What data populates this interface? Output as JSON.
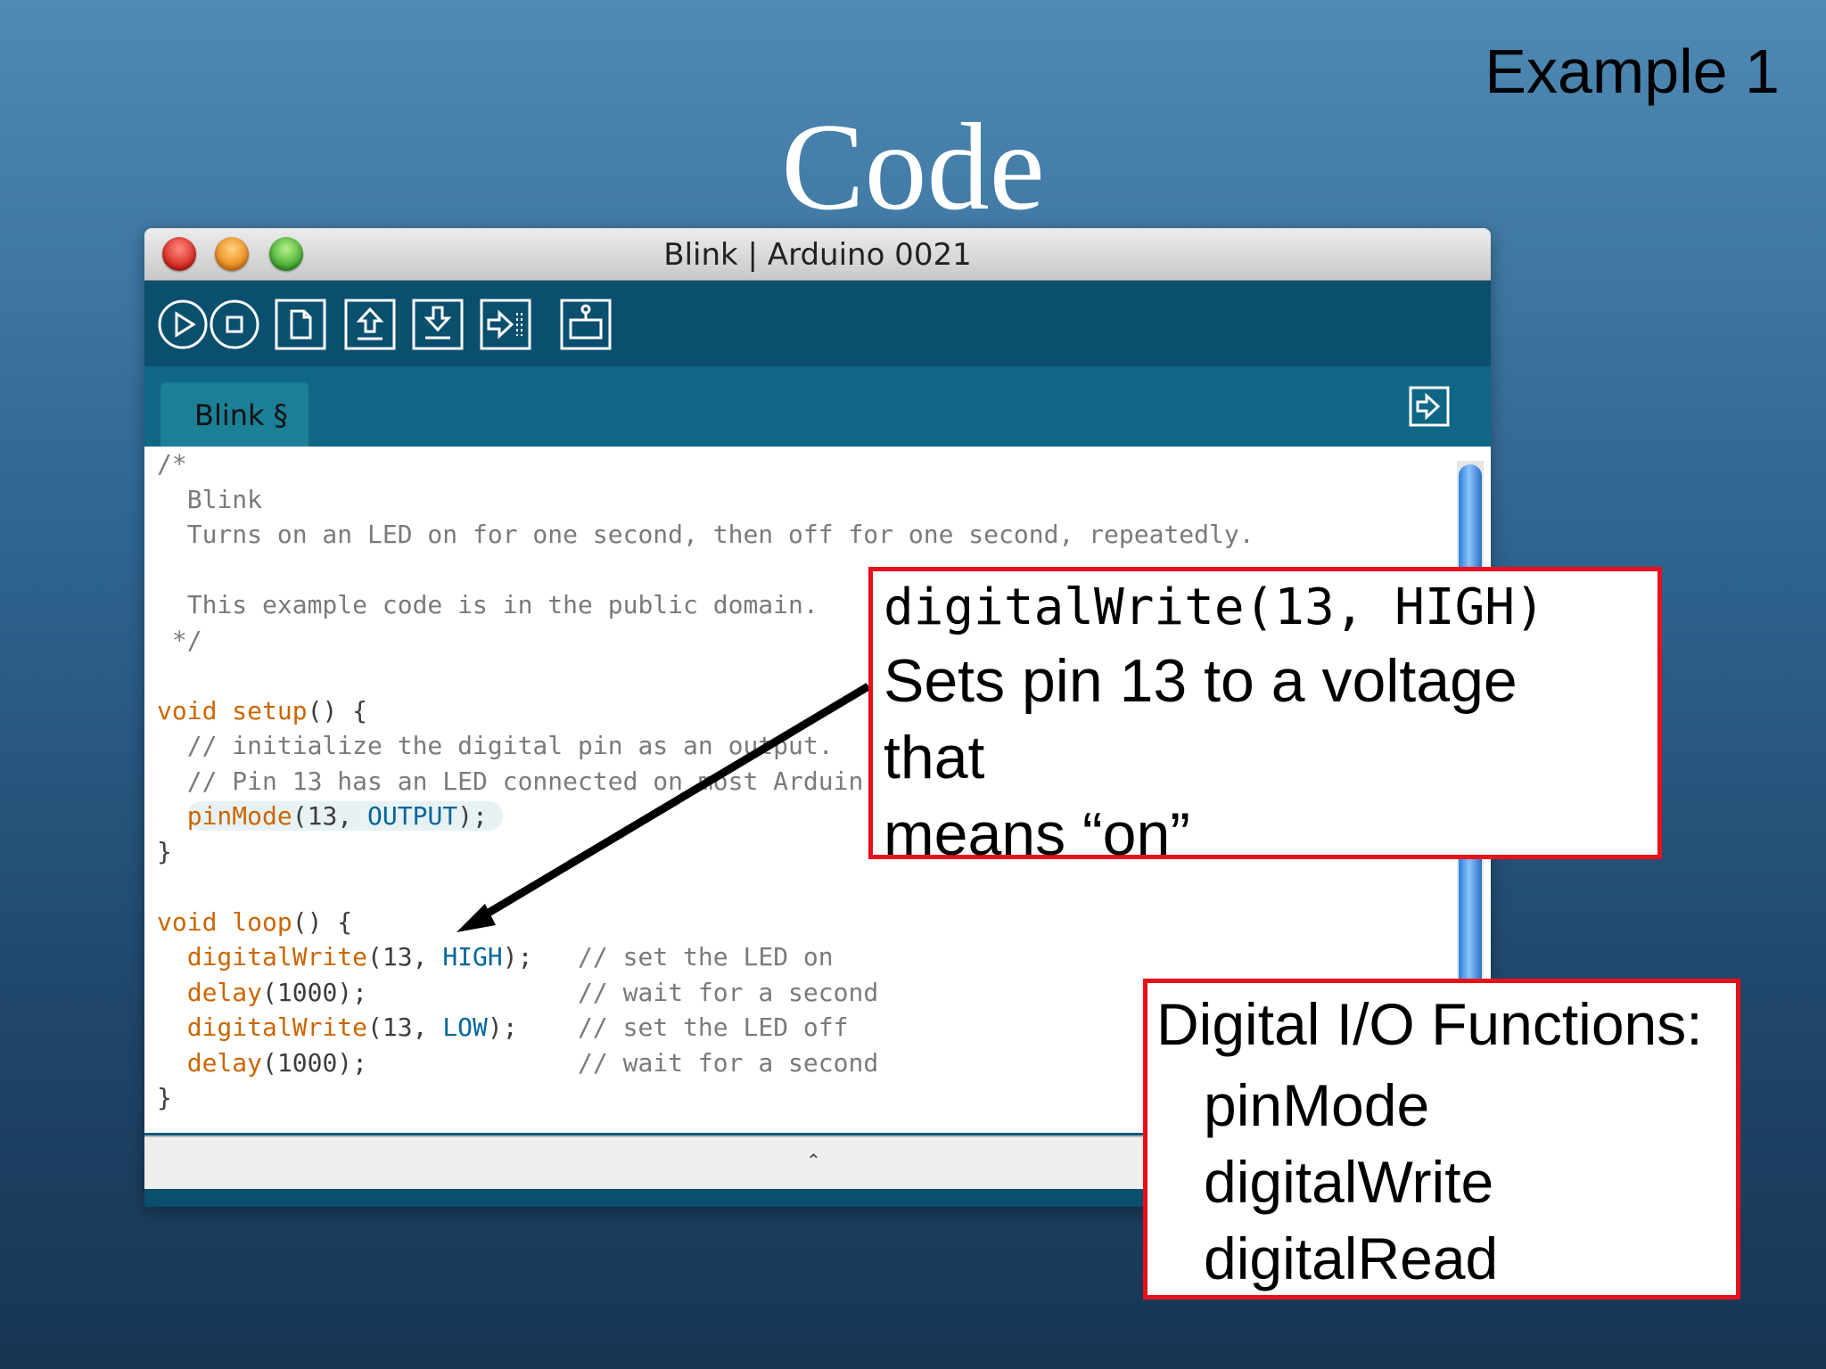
{
  "slide": {
    "label": "Example 1",
    "title": "Code"
  },
  "window": {
    "title": "Blink | Arduino 0021",
    "toolbar_icons": [
      "verify-play-icon",
      "stop-icon",
      "new-file-icon",
      "open-upload-arrow-icon",
      "save-download-arrow-icon",
      "upload-arrow-right-icon",
      "serial-monitor-icon"
    ],
    "tab_label": "Blink §",
    "code": {
      "l1": "/*",
      "l2": "  Blink",
      "l3": "  Turns on an LED on for one second, then off for one second, repeatedly.",
      "l4": "",
      "l5": "  This example code is in the public domain.",
      "l6": " */",
      "l7": "",
      "l8_kw": "void",
      "l8_fn": "setup",
      "l8_rest": "() {",
      "l9": "  // initialize the digital pin as an output.",
      "l10": "  // Pin 13 has an LED connected on most Arduin",
      "l11_fn": "pinMode",
      "l11_a": "(13, ",
      "l11_const": "OUTPUT",
      "l11_b": ");",
      "l12": "}",
      "l14_kw": "void",
      "l14_fn": "loop",
      "l14_rest": "() {",
      "l15_fn": "digitalWrite",
      "l15_a": "(13, ",
      "l15_const": "HIGH",
      "l15_b": ");",
      "l15_cm": "// set the LED on",
      "l16_fn": "delay",
      "l16_a": "(1000);",
      "l16_cm": "// wait for a second",
      "l17_fn": "digitalWrite",
      "l17_a": "(13, ",
      "l17_const": "LOW",
      "l17_b": ");",
      "l17_cm": "// set the LED off",
      "l18_fn": "delay",
      "l18_a": "(1000);",
      "l18_cm": "// wait for a second",
      "l19": "}"
    }
  },
  "callout1": {
    "code": "digitalWrite(13, HIGH)",
    "line1": "Sets pin 13 to a voltage",
    "line2": "that",
    "line3": "means “on”"
  },
  "callout2": {
    "heading": "Digital I/O Functions:",
    "items": [
      "pinMode",
      "digitalWrite",
      "digitalRead"
    ]
  },
  "colors": {
    "callout_border": "#e8101a",
    "keyword": "#cc6600",
    "constant": "#006699",
    "comment": "#7a7a7a"
  }
}
